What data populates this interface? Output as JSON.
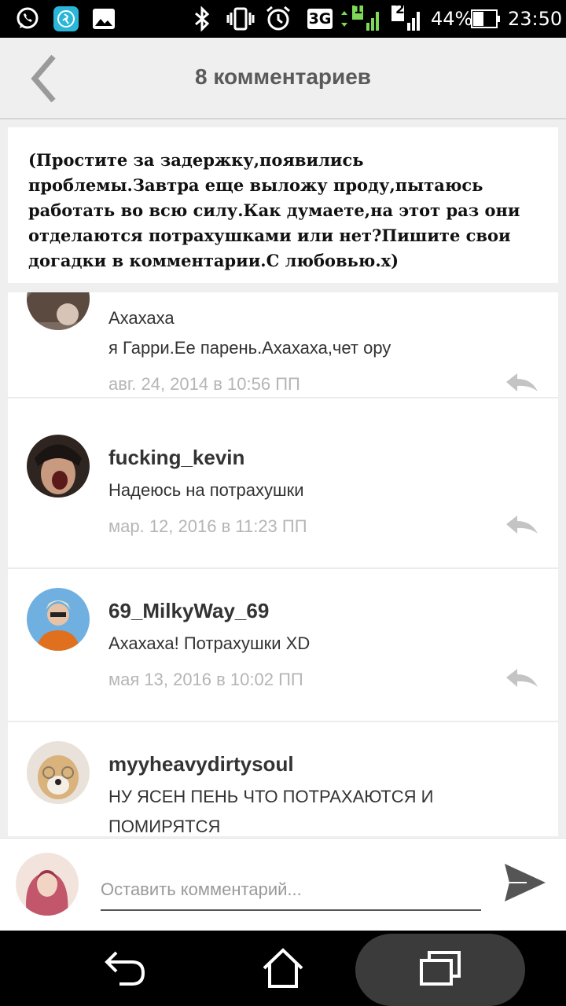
{
  "status_bar": {
    "network": "3G",
    "sim1": "1",
    "sim2": "2",
    "battery": "44%",
    "time": "23:50",
    "icons": [
      "whatsapp-icon",
      "fitness-app-icon",
      "gallery-icon",
      "bluetooth-icon",
      "vibrate-icon",
      "alarm-icon"
    ]
  },
  "header": {
    "title": "8 комментариев"
  },
  "note": {
    "text": "(Простите за задержку,появились проблемы.Завтра еще выложу проду,пытаюсь работать во всю силу.Как думаете,на этот раз они отделаются потрахушками или нет?Пишите свои догадки в комментарии.С любовью.х)"
  },
  "comments": [
    {
      "author": "",
      "lines": [
        "Ахахаха",
        "я Гарри.Ее парень.Ахахаха,чет ору"
      ],
      "date": "авг. 24, 2014 в 10:56 ПП"
    },
    {
      "author": "fucking_kevin",
      "lines": [
        "Надеюсь на потрахушки"
      ],
      "date": "мар. 12, 2016 в 11:23 ПП"
    },
    {
      "author": "69_MilkyWay_69",
      "lines": [
        "Ахахаха! Потрахушки XD"
      ],
      "date": "мая 13, 2016 в 10:02 ПП"
    },
    {
      "author": "myyheavydirtysoul",
      "lines": [
        "НУ ЯСЕН ПЕНЬ ЧТО ПОТРАХАЮТСЯ И",
        "ПОМИРЯТСЯ"
      ],
      "date": ""
    }
  ],
  "composer": {
    "placeholder": "Оставить комментарий..."
  },
  "colors": {
    "background": "#efefef",
    "title": "#5a5a5a",
    "date": "#b5b5b5",
    "accent_green": "#7ed957",
    "app_teal": "#29b6d8"
  }
}
